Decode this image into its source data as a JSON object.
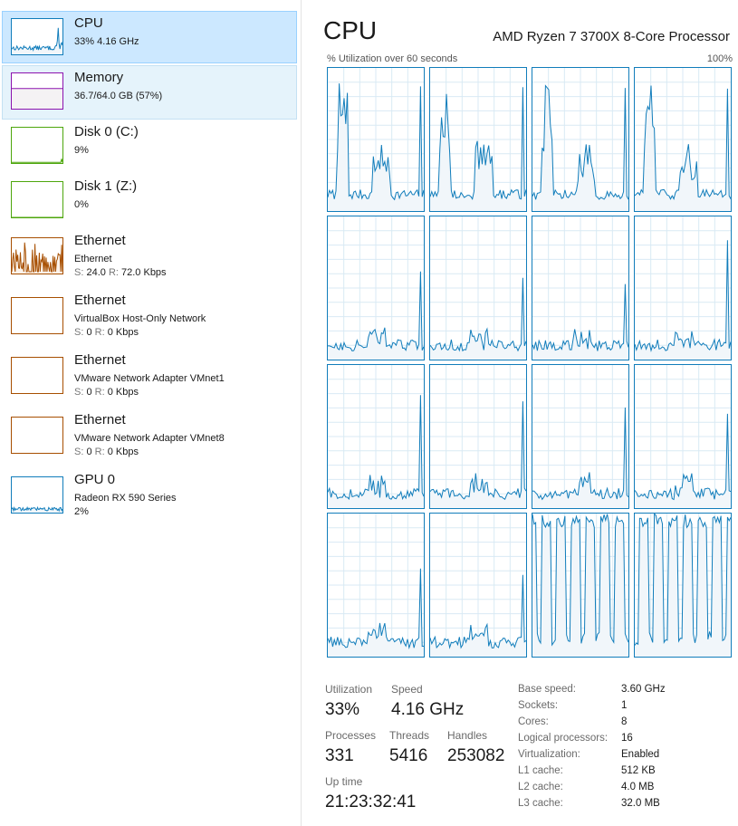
{
  "sidebar": {
    "items": [
      {
        "title": "CPU",
        "line1": "33%  4.16 GHz",
        "border": "#117dbb",
        "fill": "#f1f6fa",
        "stroke": "#117dbb",
        "kind": "cpu"
      },
      {
        "title": "Memory",
        "line1": "36.7/64.0 GB (57%)",
        "border": "#8b12ae",
        "fill": "#f4f2f4",
        "stroke": "#8b12ae",
        "kind": "memory"
      },
      {
        "title": "Disk 0 (C:)",
        "line1": "9%",
        "border": "#4da60c",
        "fill": "#eff7e8",
        "stroke": "#4da60c",
        "kind": "disk"
      },
      {
        "title": "Disk 1 (Z:)",
        "line1": "0%",
        "border": "#4da60c",
        "fill": "#eff7e8",
        "stroke": "#4da60c",
        "kind": "flat"
      },
      {
        "title": "Ethernet",
        "line1": "Ethernet",
        "send_key": "S:",
        "send_val": "24.0",
        "recv_key": "R:",
        "recv_val": "72.0 Kbps",
        "border": "#a74f01",
        "fill": "#fcf3eb",
        "stroke": "#a74f01",
        "kind": "eth"
      },
      {
        "title": "Ethernet",
        "line1": "VirtualBox Host-Only Network",
        "send_key": "S:",
        "send_val": "0",
        "recv_key": "R:",
        "recv_val": "0 Kbps",
        "border": "#a74f01",
        "fill": "#fcf3eb",
        "stroke": "#a74f01",
        "kind": "empty"
      },
      {
        "title": "Ethernet",
        "line1": "VMware Network Adapter VMnet1",
        "send_key": "S:",
        "send_val": "0",
        "recv_key": "R:",
        "recv_val": "0 Kbps",
        "border": "#a74f01",
        "fill": "#fcf3eb",
        "stroke": "#a74f01",
        "kind": "empty"
      },
      {
        "title": "Ethernet",
        "line1": "VMware Network Adapter VMnet8",
        "send_key": "S:",
        "send_val": "0",
        "recv_key": "R:",
        "recv_val": "0 Kbps",
        "border": "#a74f01",
        "fill": "#fcf3eb",
        "stroke": "#a74f01",
        "kind": "empty"
      },
      {
        "title": "GPU 0",
        "line1": "Radeon RX 590 Series",
        "line2": "2%",
        "border": "#117dbb",
        "fill": "#f1f6fa",
        "stroke": "#117dbb",
        "kind": "gpu"
      }
    ]
  },
  "main": {
    "title": "CPU",
    "processor": "AMD Ryzen 7 3700X 8-Core Processor",
    "utilization_caption": "% Utilization over 60 seconds",
    "max_label": "100%",
    "graph_colors": {
      "border": "#117dbb",
      "grid": "#d9eaf4",
      "fill": "#f1f6fa",
      "line": "#117dbb"
    }
  },
  "stats": {
    "utilization_label": "Utilization",
    "utilization": "33%",
    "speed_label": "Speed",
    "speed": "4.16 GHz",
    "processes_label": "Processes",
    "processes": "331",
    "threads_label": "Threads",
    "threads": "5416",
    "handles_label": "Handles",
    "handles": "253082",
    "uptime_label": "Up time",
    "uptime": "21:23:32:41"
  },
  "specs": [
    {
      "key": "Base speed:",
      "value": "3.60 GHz"
    },
    {
      "key": "Sockets:",
      "value": "1"
    },
    {
      "key": "Cores:",
      "value": "8"
    },
    {
      "key": "Logical processors:",
      "value": "16"
    },
    {
      "key": "Virtualization:",
      "value": "Enabled"
    },
    {
      "key": "L1 cache:",
      "value": "512 KB"
    },
    {
      "key": "L2 cache:",
      "value": "4.0 MB"
    },
    {
      "key": "L3 cache:",
      "value": "32.0 MB"
    }
  ]
}
